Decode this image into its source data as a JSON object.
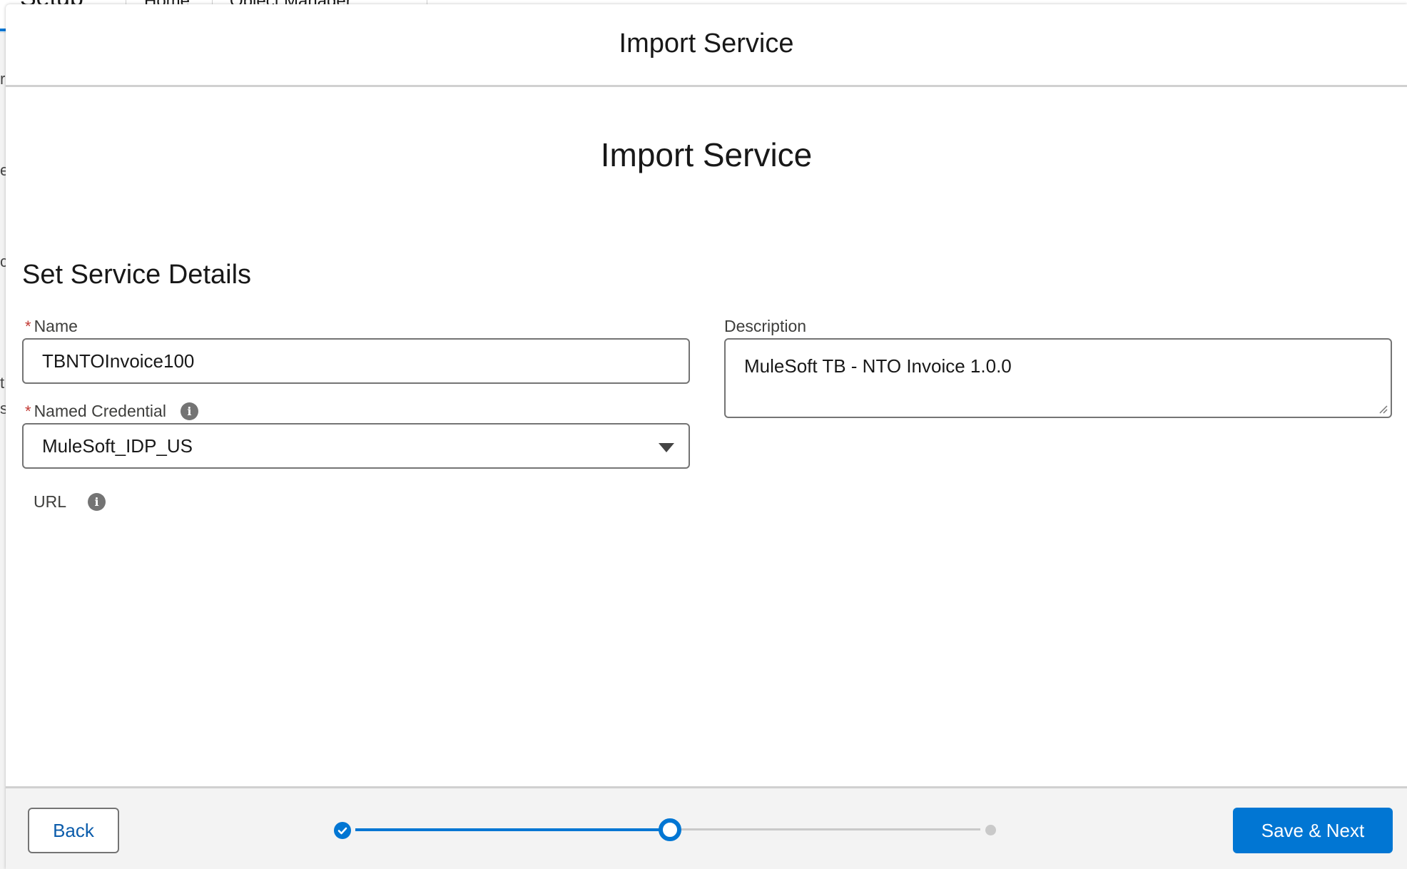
{
  "background": {
    "app_title": "Setup",
    "tabs": [
      "Home",
      "Object Manager"
    ],
    "edge_letters": [
      "r",
      "e",
      "c",
      "t",
      "si"
    ]
  },
  "modal": {
    "title": "Import Service",
    "heading": "Import Service",
    "section_title": "Set Service Details",
    "name": {
      "label": "Name",
      "required_mark": "*",
      "value": "TBNTOInvoice100"
    },
    "named_credential": {
      "label": "Named Credential",
      "required_mark": "*",
      "value": "MuleSoft_IDP_US"
    },
    "url": {
      "label": "URL"
    },
    "description": {
      "label": "Description",
      "value": "MuleSoft TB - NTO Invoice 1.0.0"
    },
    "info_icon_glyph": "i",
    "footer": {
      "back_label": "Back",
      "save_next_label": "Save & Next",
      "progress": {
        "total_steps": 3,
        "current_step": 2
      }
    }
  },
  "colors": {
    "brand_blue": "#0176d3",
    "link_blue": "#0b5cab",
    "required_red": "#c23934",
    "border_gray": "#747474"
  }
}
